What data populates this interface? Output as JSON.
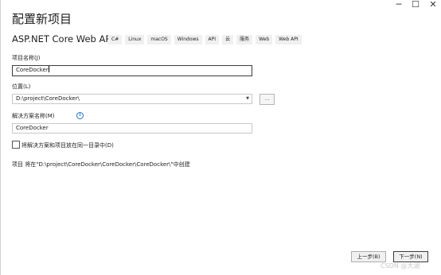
{
  "window": {
    "minimize": "─",
    "maximize": "☐",
    "close": "✕"
  },
  "title": "配置新项目",
  "template": {
    "name": "ASP.NET Core Web API",
    "tags": [
      "C#",
      "Linux",
      "macOS",
      "Windows",
      "API",
      "云",
      "服务",
      "Web",
      "Web API"
    ]
  },
  "form": {
    "project_name_label": "项目名称(J)",
    "project_name_value": "CoreDocker",
    "location_label": "位置(L)",
    "location_value": "D:\\project\\CoreDocker\\",
    "location_browse": "...",
    "solution_label": "解决方案名称(M)",
    "solution_info_icon": "i",
    "solution_value": "CoreDocker",
    "same_dir_label": "将解决方案和项目放在同一目录中(D)",
    "same_dir_checked": false,
    "path_info": "项目 将在\"D:\\project\\CoreDocker\\CoreDocker\\CoreDocker\\\"中创建"
  },
  "buttons": {
    "back": "上一步(B)",
    "next": "下一步(N)"
  },
  "watermark": "CSDN @大湖"
}
